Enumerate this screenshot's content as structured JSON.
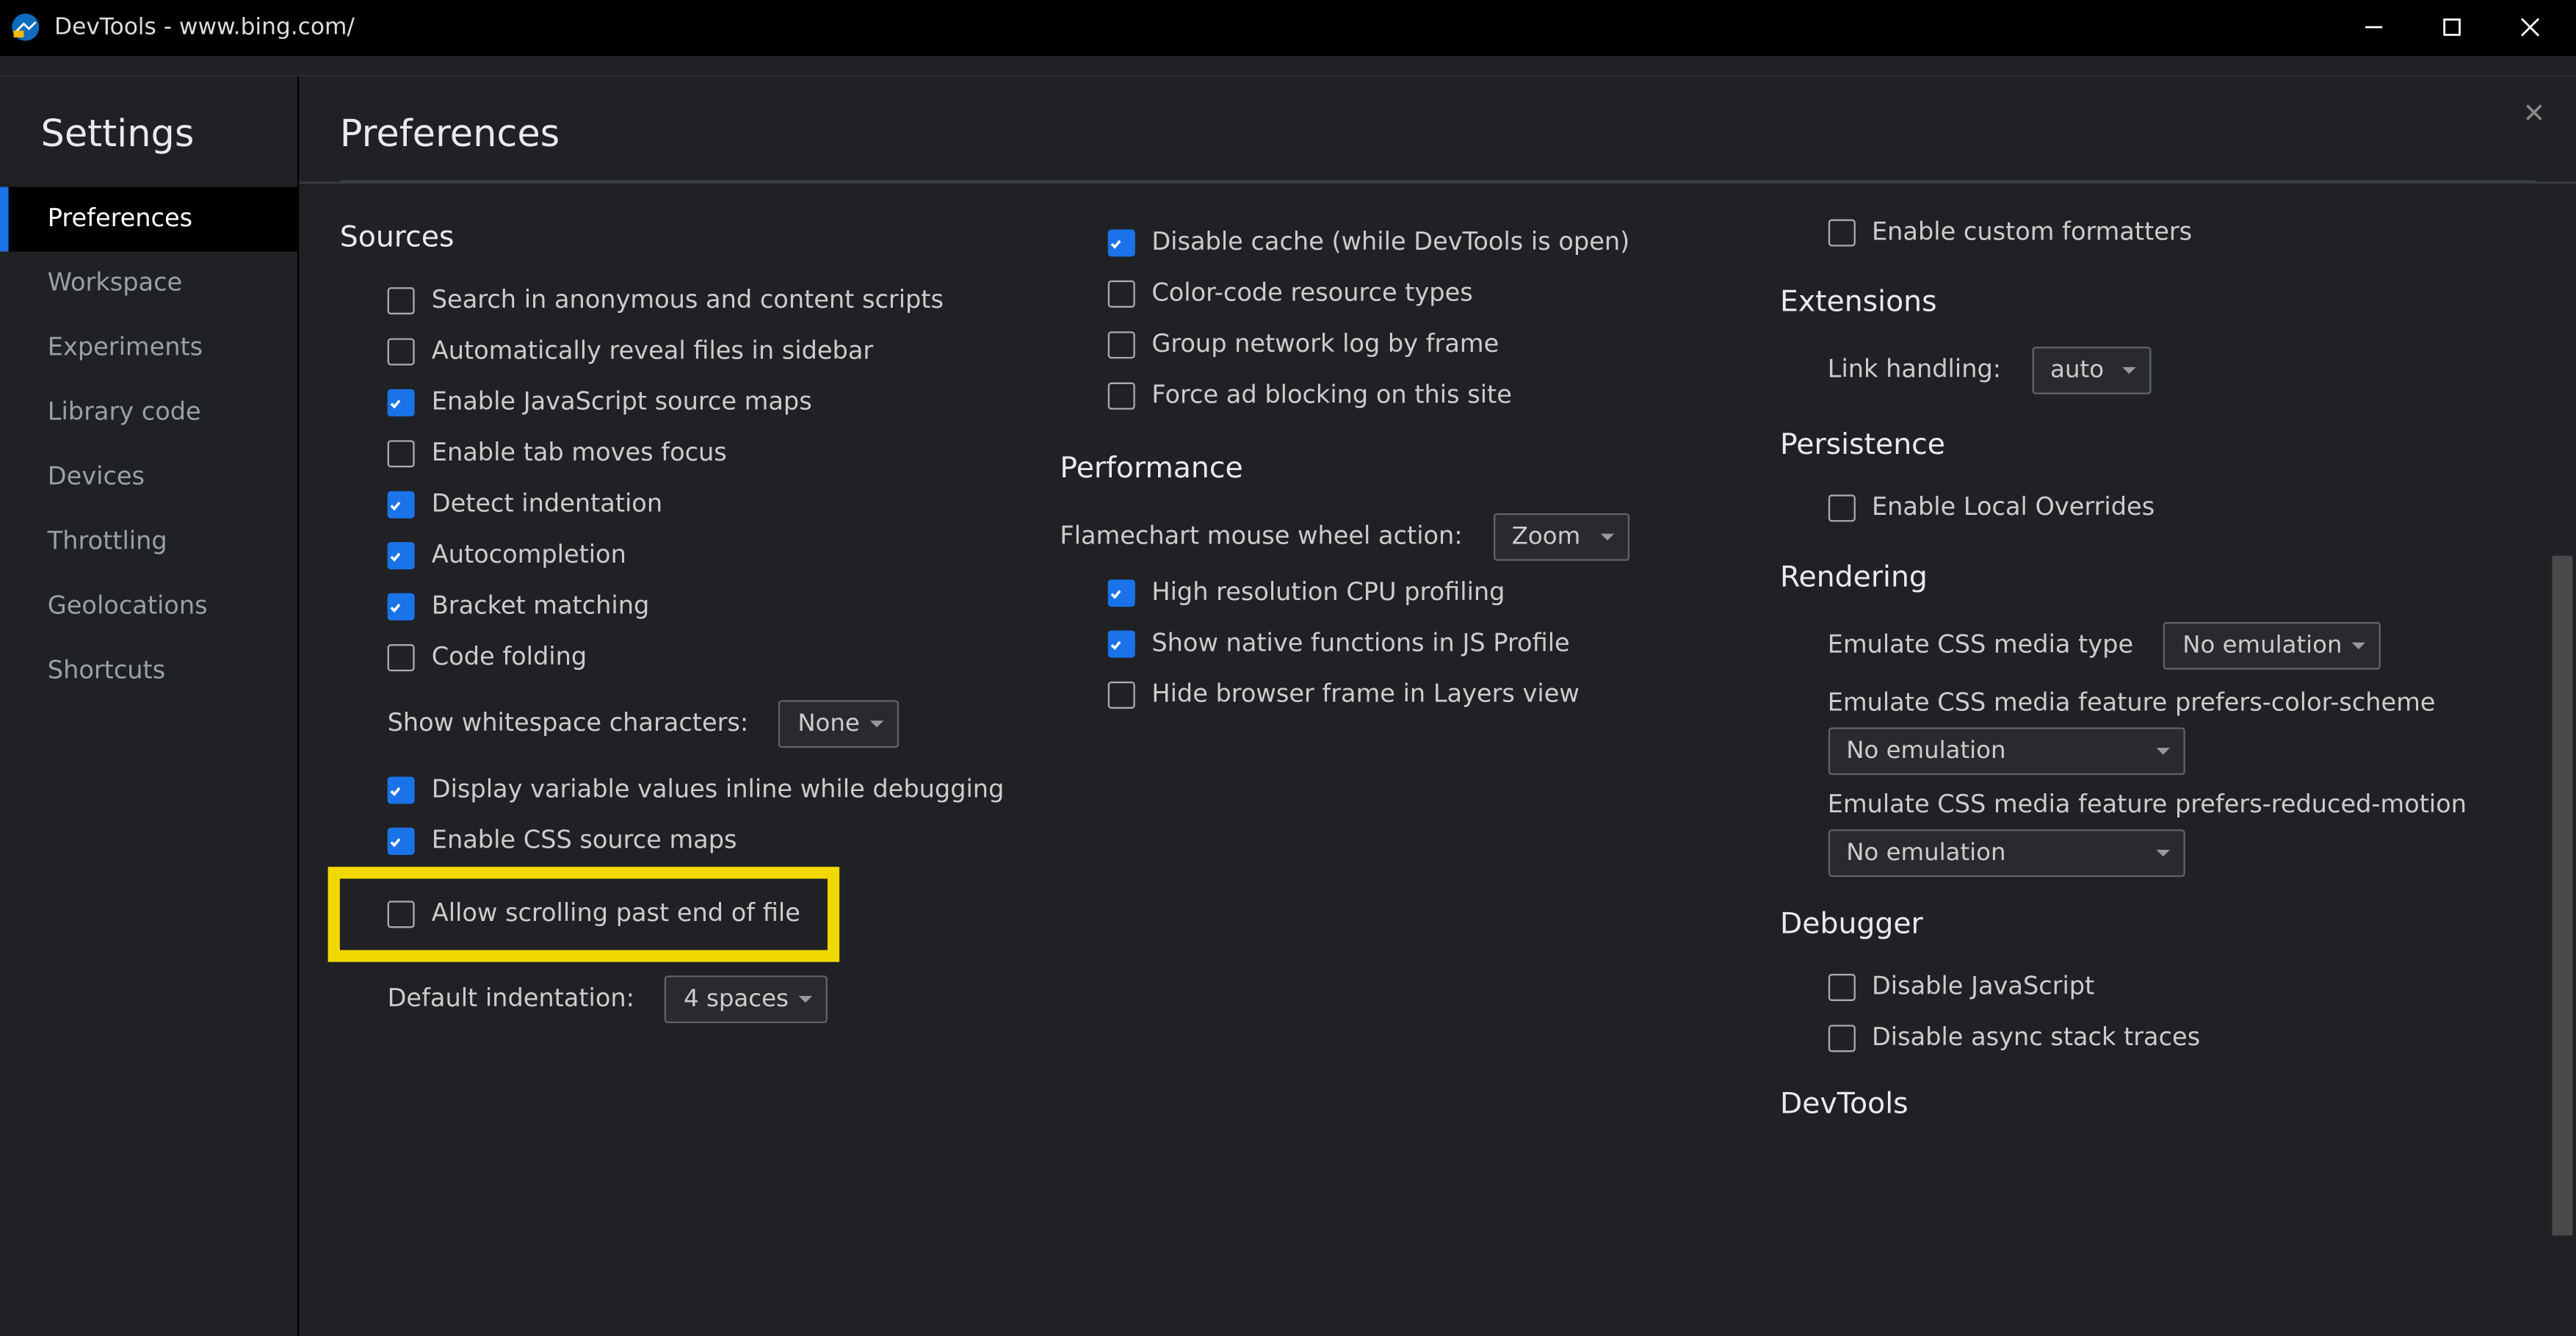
{
  "window": {
    "title": "DevTools - www.bing.com/"
  },
  "sidebar": {
    "title": "Settings",
    "items": [
      {
        "label": "Preferences",
        "active": true
      },
      {
        "label": "Workspace"
      },
      {
        "label": "Experiments"
      },
      {
        "label": "Library code"
      },
      {
        "label": "Devices"
      },
      {
        "label": "Throttling"
      },
      {
        "label": "Geolocations"
      },
      {
        "label": "Shortcuts"
      }
    ]
  },
  "main": {
    "title": "Preferences"
  },
  "col1": {
    "section": "Sources",
    "items": [
      {
        "label": "Search in anonymous and content scripts",
        "checked": false
      },
      {
        "label": "Automatically reveal files in sidebar",
        "checked": false
      },
      {
        "label": "Enable JavaScript source maps",
        "checked": true
      },
      {
        "label": "Enable tab moves focus",
        "checked": false
      },
      {
        "label": "Detect indentation",
        "checked": true
      },
      {
        "label": "Autocompletion",
        "checked": true
      },
      {
        "label": "Bracket matching",
        "checked": true
      },
      {
        "label": "Code folding",
        "checked": false
      }
    ],
    "whitespace_label": "Show whitespace characters:",
    "whitespace_value": "None",
    "items2": [
      {
        "label": "Display variable values inline while debugging",
        "checked": true
      },
      {
        "label": "Enable CSS source maps",
        "checked": true
      }
    ],
    "highlighted": {
      "label": "Allow scrolling past end of file",
      "checked": false
    },
    "indent_label": "Default indentation:",
    "indent_value": "4 spaces"
  },
  "col2": {
    "items_top": [
      {
        "label": "Disable cache (while DevTools is open)",
        "checked": true
      },
      {
        "label": "Color-code resource types",
        "checked": false
      },
      {
        "label": "Group network log by frame",
        "checked": false
      },
      {
        "label": "Force ad blocking on this site",
        "checked": false
      }
    ],
    "perf_title": "Performance",
    "flame_label": "Flamechart mouse wheel action:",
    "flame_value": "Zoom",
    "perf_items": [
      {
        "label": "High resolution CPU profiling",
        "checked": true
      },
      {
        "label": "Show native functions in JS Profile",
        "checked": true
      },
      {
        "label": "Hide browser frame in Layers view",
        "checked": false
      }
    ]
  },
  "col3": {
    "top_item": {
      "label": "Enable custom formatters",
      "checked": false
    },
    "ext_title": "Extensions",
    "link_label": "Link handling:",
    "link_value": "auto",
    "pers_title": "Persistence",
    "pers_item": {
      "label": "Enable Local Overrides",
      "checked": false
    },
    "rend_title": "Rendering",
    "emu_media_label": "Emulate CSS media type",
    "emu_media_value": "No emulation",
    "emu_color_label": "Emulate CSS media feature prefers-color-scheme",
    "emu_color_value": "No emulation",
    "emu_motion_label": "Emulate CSS media feature prefers-reduced-motion",
    "emu_motion_value": "No emulation",
    "dbg_title": "Debugger",
    "dbg_items": [
      {
        "label": "Disable JavaScript",
        "checked": false
      },
      {
        "label": "Disable async stack traces",
        "checked": false
      }
    ],
    "dev_title": "DevTools"
  }
}
